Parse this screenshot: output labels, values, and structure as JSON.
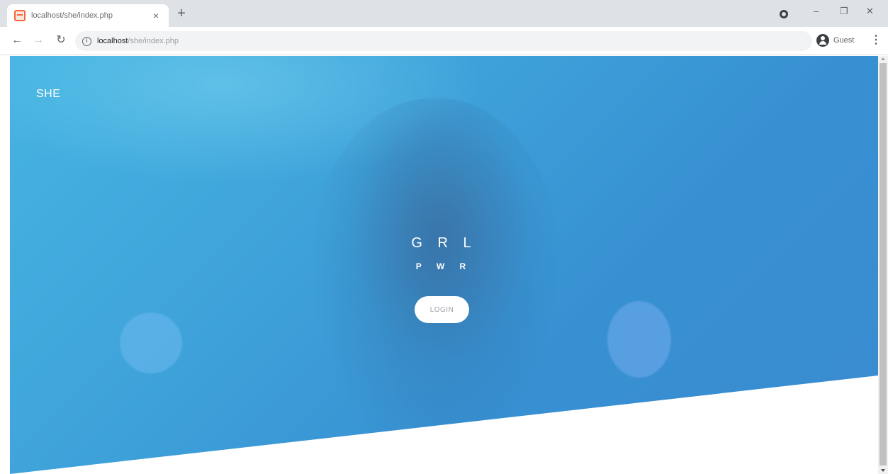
{
  "browser": {
    "tab_title": "localhost/she/index.php",
    "tab_close": "×",
    "new_tab": "+",
    "url_host": "localhost",
    "url_path": "/she/index.php",
    "profile_label": "Guest",
    "icons": {
      "back": "back-arrow-icon",
      "forward": "forward-arrow-icon",
      "reload": "reload-icon",
      "info": "info-icon",
      "profile": "profile-icon",
      "menu": "kebab-menu-icon"
    }
  },
  "page": {
    "brand": "SHE",
    "title": "G R L",
    "subtitle": "P W R",
    "login_label": "LOGIN",
    "colors": {
      "hero_start": "#45b4e2",
      "hero_end": "#3a8bd0",
      "button_bg": "#ffffff"
    }
  }
}
